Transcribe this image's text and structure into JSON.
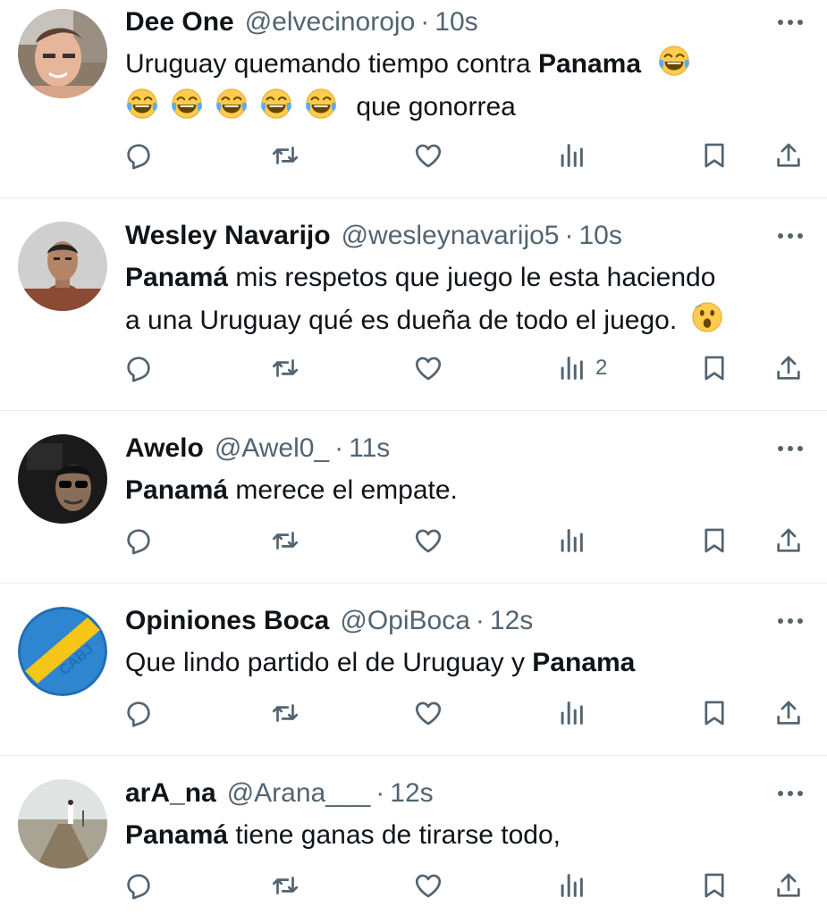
{
  "tweets": [
    {
      "name": "Dee One",
      "handle": "@elvecinorojo",
      "time": "10s",
      "line1_before": "Uruguay quemando tiempo contra ",
      "line1_bold": "Panama",
      "line2_text": "que gonorrea",
      "views": ""
    },
    {
      "name": "Wesley Navarijo",
      "handle": "@wesleynavarijo5",
      "time": "10s",
      "bold": "Panamá",
      "line1_rest": " mis respetos que juego le esta haciendo",
      "line2": "a una Uruguay qué es dueña de todo el juego.",
      "views": "2"
    },
    {
      "name": "Awelo",
      "handle": "@Awel0_",
      "time": "11s",
      "bold": "Panamá",
      "rest": " merece el empate.",
      "views": ""
    },
    {
      "name": "Opiniones Boca",
      "handle": "@OpiBoca",
      "time": "12s",
      "before": "Que lindo partido el de Uruguay y ",
      "bold": "Panama",
      "views": ""
    },
    {
      "name": "arA_na",
      "handle": "@Arana___",
      "time": "12s",
      "bold": "Panamá",
      "rest": " tiene ganas de tirarse todo,",
      "views": ""
    }
  ],
  "common": {
    "separator": "·"
  },
  "icons": [
    "reply-icon",
    "retweet-icon",
    "like-icon",
    "views-icon",
    "bookmark-icon",
    "share-icon",
    "more-icon",
    "laughing-emoji",
    "astonished-emoji"
  ],
  "colors": {
    "text": "#0f1419",
    "secondary": "#536471",
    "divider": "#e6ecf0"
  }
}
